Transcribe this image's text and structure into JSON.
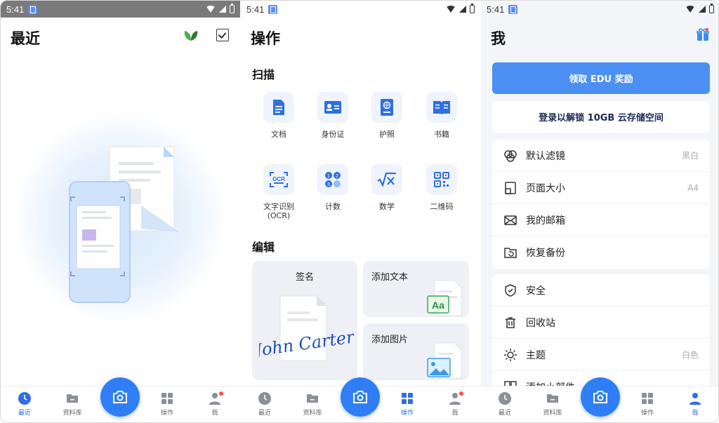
{
  "status": {
    "time": "5:41"
  },
  "panel_recent": {
    "title": "最近"
  },
  "panel_actions": {
    "title": "操作",
    "scan_section": "扫描",
    "scan_tools": [
      "文档",
      "身份证",
      "护照",
      "书籍"
    ],
    "ocr_label_line1": "文字识别",
    "ocr_label_line2": "(OCR)",
    "ocr_icon_text": "OCR",
    "count_label": "计数",
    "math_label": "数学",
    "qr_label": "二维码",
    "count_icon_digits": [
      "1",
      "2",
      "3"
    ],
    "edit_section": "编辑",
    "sign_label": "签名",
    "signature_text": "John Carter",
    "add_text_label": "添加文本",
    "add_text_icon": "Aa",
    "add_image_label": "添加图片"
  },
  "panel_me": {
    "title": "我",
    "edu_button": "领取 EDU 奖励",
    "login_card": "登录以解锁 10GB 云存储空间",
    "settings_group1": [
      {
        "label": "默认滤镜",
        "value": "黑白"
      },
      {
        "label": "页面大小",
        "value": "A4"
      },
      {
        "label": "我的邮箱",
        "value": ""
      },
      {
        "label": "恢复备份",
        "value": ""
      }
    ],
    "settings_group2": [
      {
        "label": "安全",
        "value": ""
      },
      {
        "label": "回收站",
        "value": ""
      },
      {
        "label": "主题",
        "value": "白色"
      },
      {
        "label": "添加小部件",
        "value": ""
      }
    ]
  },
  "bottom_nav": {
    "recent": "最近",
    "library": "资料库",
    "actions": "操作",
    "me": "我"
  },
  "colors": {
    "accent": "#2f7ef5",
    "active": "#2f6fe0",
    "edu_button": "#4b8ff2"
  }
}
